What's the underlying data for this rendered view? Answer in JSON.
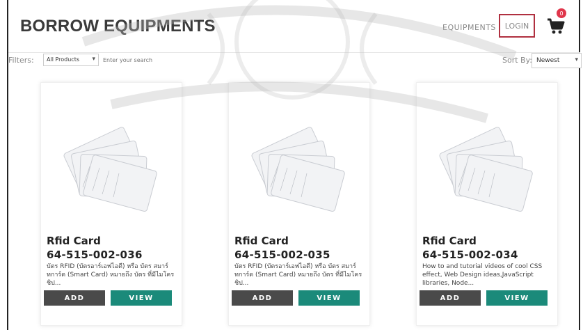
{
  "header": {
    "brand": "BORROW EQUIPMENTS",
    "nav_equipments": "EQUIPMENTS",
    "nav_login": "LOGIN",
    "cart_icon": "shopping-cart-icon",
    "cart_count": "0",
    "colors": {
      "login_border": "#b03040",
      "badge": "#e0364b"
    }
  },
  "filters": {
    "label": "Filters:",
    "category_selected": "All Products",
    "search_placeholder": "Enter your search",
    "sort_label": "Sort By:",
    "sort_selected": "Newest"
  },
  "products": [
    {
      "title": "Rfid Card",
      "code": "64-515-002-036",
      "description": "บัตร RFID (บัตรอาร์เอฟไอดี) หรือ บัตร สมาร์ทการ์ด (Smart Card) หมายถึง บัตร ที่มีไมโครชิป...",
      "add_label": "ADD",
      "view_label": "VIEW"
    },
    {
      "title": "Rfid Card",
      "code": "64-515-002-035",
      "description": "บัตร RFID (บัตรอาร์เอฟไอดี) หรือ บัตร สมาร์ทการ์ด (Smart Card) หมายถึง บัตร ที่มีไมโครชิป...",
      "add_label": "ADD",
      "view_label": "VIEW"
    },
    {
      "title": "Rfid Card",
      "code": "64-515-002-034",
      "description": "How to and tutorial videos of cool CSS effect, Web Design ideas,JavaScript libraries, Node...",
      "add_label": "ADD",
      "view_label": "VIEW"
    }
  ],
  "colors": {
    "add_button": "#4a4a4a",
    "view_button": "#1b8a7a"
  }
}
